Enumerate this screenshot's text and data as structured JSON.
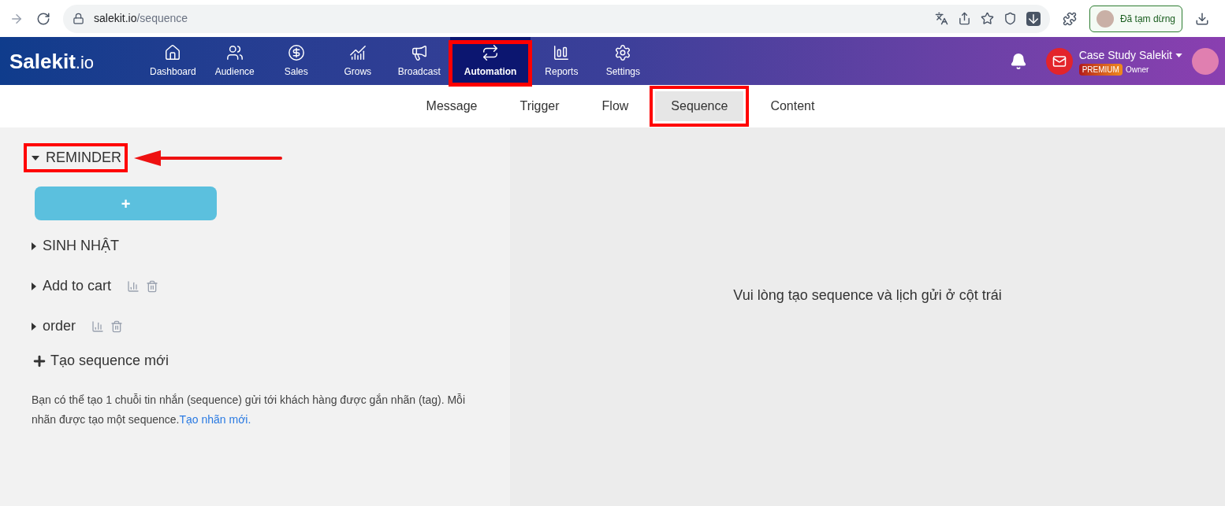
{
  "browser": {
    "url_host": "salekit.io",
    "url_path": "/sequence",
    "profile_label": "Đã tạm dừng"
  },
  "nav": {
    "logo_main": "Salekit",
    "logo_suffix": ".io",
    "items": [
      {
        "label": "Dashboard",
        "selected": false,
        "annotated": false
      },
      {
        "label": "Audience",
        "selected": false,
        "annotated": false
      },
      {
        "label": "Sales",
        "selected": false,
        "annotated": false
      },
      {
        "label": "Grows",
        "selected": false,
        "annotated": false
      },
      {
        "label": "Broadcast",
        "selected": false,
        "annotated": false
      },
      {
        "label": "Automation",
        "selected": true,
        "annotated": true
      },
      {
        "label": "Reports",
        "selected": false,
        "annotated": false
      },
      {
        "label": "Settings",
        "selected": false,
        "annotated": false
      }
    ],
    "account": {
      "name": "Case Study Salekit",
      "badge": "PREMIUM",
      "role": "Owner"
    }
  },
  "tabs": [
    {
      "label": "Message",
      "selected": false,
      "annotated": false
    },
    {
      "label": "Trigger",
      "selected": false,
      "annotated": false
    },
    {
      "label": "Flow",
      "selected": false,
      "annotated": false
    },
    {
      "label": "Sequence",
      "selected": true,
      "annotated": true
    },
    {
      "label": "Content",
      "selected": false,
      "annotated": false
    }
  ],
  "sequences": [
    {
      "name": "REMINDER",
      "expanded": true,
      "annotated": true,
      "actions": false
    },
    {
      "name": "SINH NHẬT",
      "expanded": false,
      "annotated": false,
      "actions": false
    },
    {
      "name": "Add to cart",
      "expanded": false,
      "annotated": false,
      "actions": true
    },
    {
      "name": "order",
      "expanded": false,
      "annotated": false,
      "actions": true
    }
  ],
  "add_step_button": "+",
  "new_sequence": "Tạo sequence mới",
  "help_text": "Bạn có thể tạo 1 chuỗi tin nhắn (sequence) gửi tới khách hàng được gắn nhãn (tag). Mỗi nhãn được tạo một sequence.",
  "help_link": "Tạo nhãn mới.",
  "empty_message": "Vui lòng tạo sequence và lịch gửi ở cột trái"
}
